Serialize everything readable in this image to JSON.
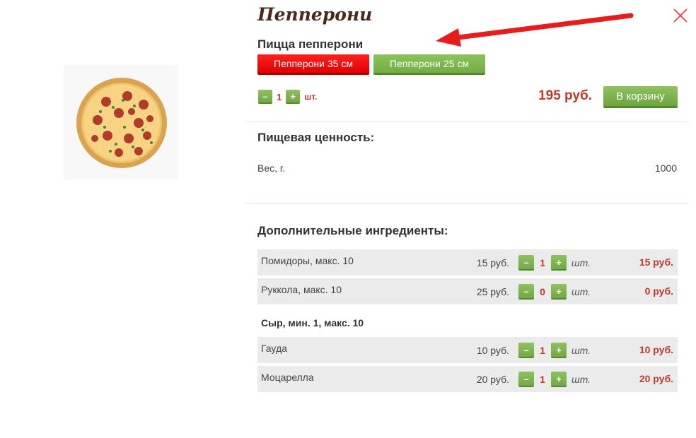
{
  "product": {
    "title": "Пепперони",
    "subtitle": "Пицца пепперони",
    "image_icon": "pizza-icon"
  },
  "sizes": [
    {
      "label": "Пепперони 35 см",
      "active": true
    },
    {
      "label": "Пепперони 25 см",
      "active": false
    }
  ],
  "order": {
    "minus": "–",
    "plus": "+",
    "quantity": "1",
    "unit": "шт.",
    "price": "195 руб.",
    "cart_label": "В корзину"
  },
  "nutrition": {
    "heading": "Пищевая ценность:",
    "weight_label": "Вес, г.",
    "weight_value": "1000"
  },
  "extras": {
    "heading": "Дополнительные ингредиенты:",
    "items": [
      {
        "name": "Помидоры, макс. 10",
        "price": "15 руб.",
        "qty": "1",
        "unit": "шт.",
        "total": "15 руб."
      },
      {
        "name": "Руккола, макс. 10",
        "price": "25 руб.",
        "qty": "0",
        "unit": "шт.",
        "total": "0 руб."
      }
    ],
    "cheese_group": {
      "heading": "Сыр, мин. 1, макс. 10",
      "items": [
        {
          "name": "Гауда",
          "price": "10 руб.",
          "qty": "1",
          "unit": "шт.",
          "total": "10 руб."
        },
        {
          "name": "Моцарелла",
          "price": "20 руб.",
          "qty": "1",
          "unit": "шт.",
          "total": "20 руб."
        }
      ]
    }
  },
  "colors": {
    "accent_red": "#e00000",
    "accent_green": "#74ad44",
    "price_red": "#c0392b",
    "close_red": "#e8453c"
  },
  "icons": {
    "close": "close-icon",
    "arrow": "red-arrow-annotation"
  }
}
